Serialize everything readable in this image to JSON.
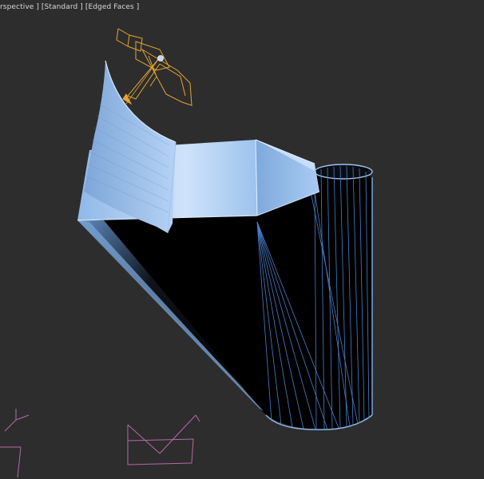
{
  "viewport": {
    "labels": {
      "view": "rspective ]",
      "shading": "[Standard ]",
      "mode": "[Edged Faces ]"
    }
  },
  "colors": {
    "background": "#2d2d2d",
    "mesh_light": "#a9cdf4",
    "mesh_mid": "#6f9ccc",
    "mesh_dark": "#000000",
    "wire_edges": "#5b8fe0",
    "light_gizmo": "#e8a82a",
    "grid_gizmo": "#b56aa6"
  },
  "icons": {
    "light": "spotlight-gizmo-icon",
    "axis_left": "axis-tripod-icon",
    "grid": "grid-helper-icon"
  }
}
